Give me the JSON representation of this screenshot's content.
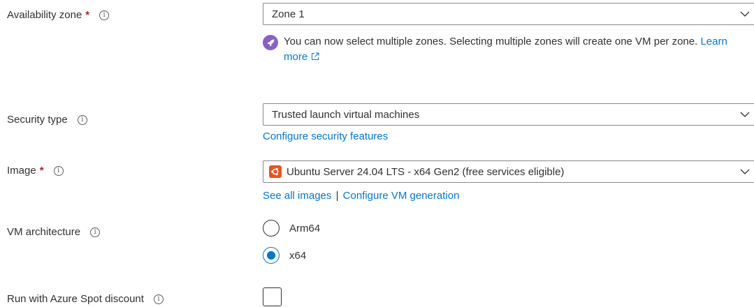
{
  "availability_zone": {
    "label": "Availability zone",
    "required_mark": "*",
    "selected": "Zone 1",
    "note": "You can now select multiple zones. Selecting multiple zones will create one VM per zone.",
    "learn_more": "Learn more"
  },
  "security_type": {
    "label": "Security type",
    "selected": "Trusted launch virtual machines",
    "configure_link": "Configure security features"
  },
  "image": {
    "label": "Image",
    "required_mark": "*",
    "selected": "Ubuntu Server 24.04 LTS - x64 Gen2 (free services eligible)",
    "see_all_link": "See all images",
    "separator": "|",
    "configure_link": "Configure VM generation"
  },
  "vm_architecture": {
    "label": "VM architecture",
    "options": [
      {
        "label": "Arm64",
        "checked": false
      },
      {
        "label": "x64",
        "checked": true
      }
    ]
  },
  "spot": {
    "label": "Run with Azure Spot discount",
    "checked": false
  },
  "colors": {
    "link": "#0078d4",
    "required": "#a4262c",
    "ubuntu": "#e95420",
    "note_icon": "#8661c5"
  }
}
